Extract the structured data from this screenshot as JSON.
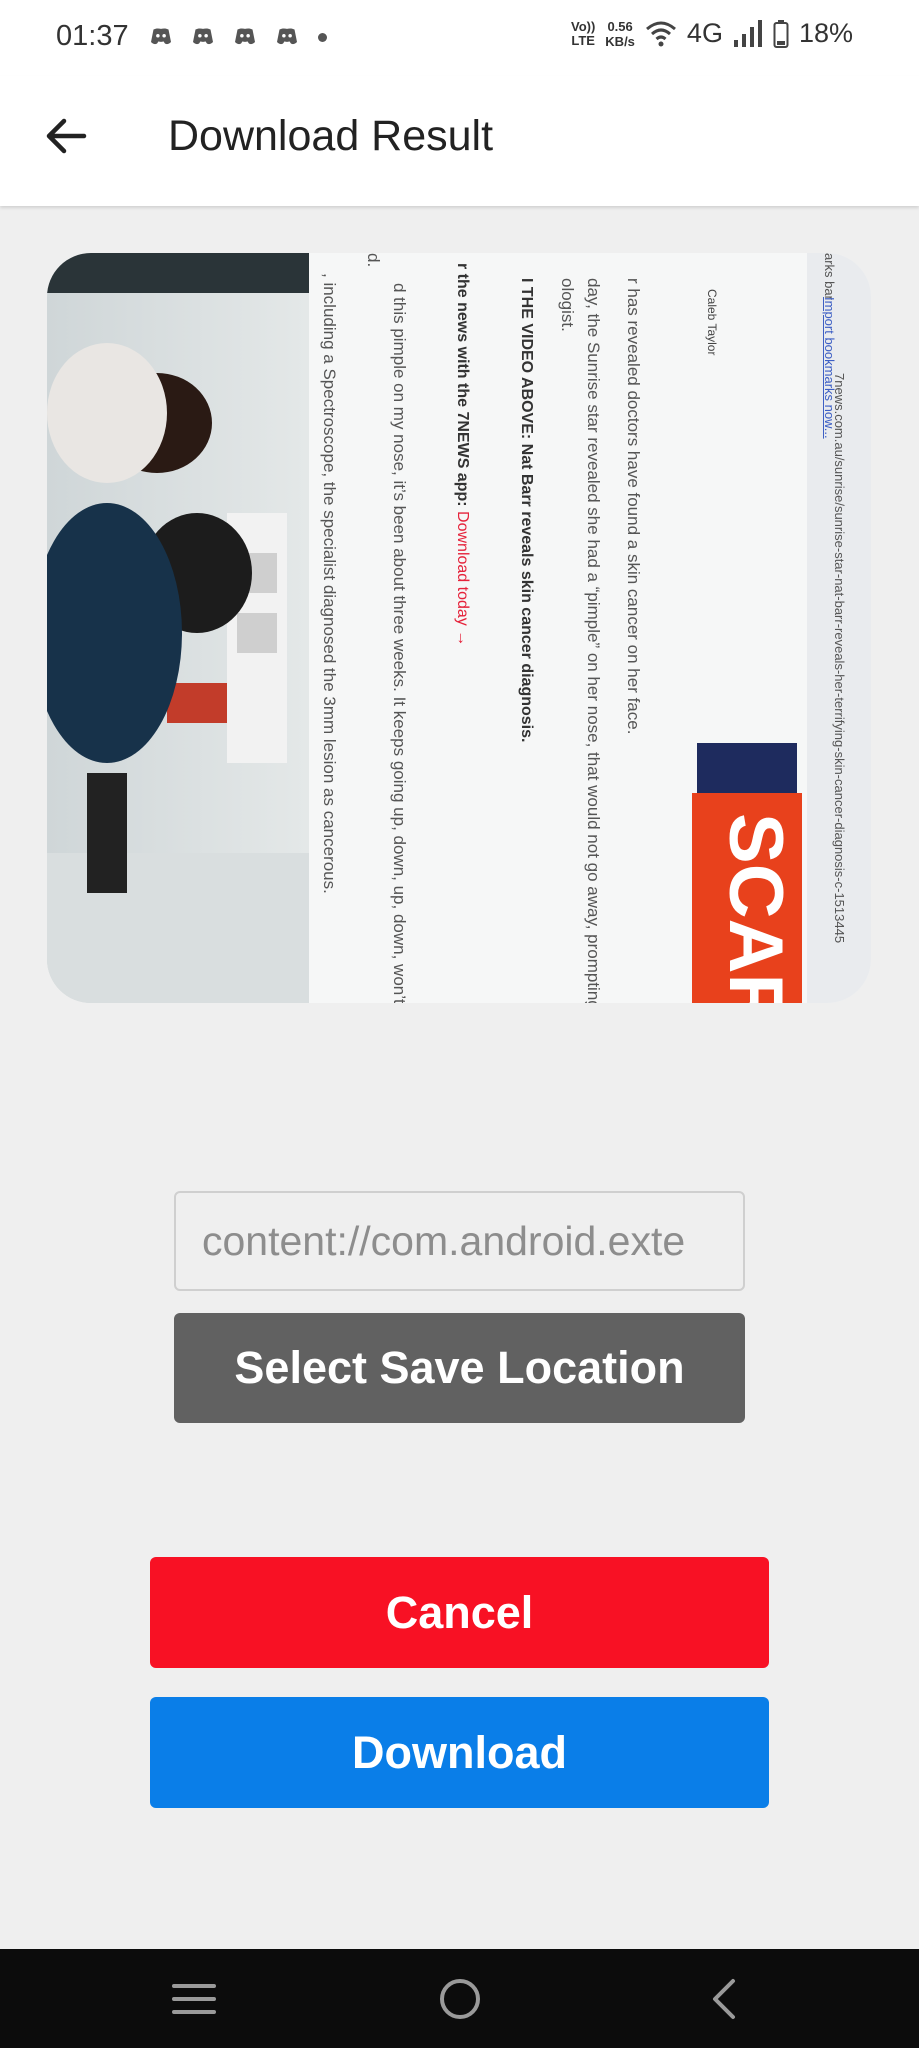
{
  "status_bar": {
    "time": "01:37",
    "volte": "Vo)) LTE",
    "volte_top": "Vo))",
    "volte_bottom": "LTE",
    "net_speed_value": "0.56",
    "net_speed_unit": "KB/s",
    "network_type": "4G",
    "battery": "18%",
    "icons": [
      "discord-icon",
      "discord-icon",
      "discord-icon",
      "discord-icon",
      "dot-icon",
      "wifi-icon",
      "signal-icon",
      "battery-icon"
    ]
  },
  "app_bar": {
    "title": "Download Result",
    "back_icon": "arrow-left-icon"
  },
  "preview": {
    "url_line": "7news.com.au/sunrise/sunrise-star-nat-barr-reveals-her-terrifying-skin-cancer-diagnosis-c-1513445",
    "bookmarks_prefix": "arks bar",
    "bookmarks_link": "Import bookmarks now...",
    "author": "Caleb Taylor",
    "lines": [
      "r has revealed doctors have found a skin cancer on her face.",
      "day, the Sunrise star revealed she had a “pimple” on her nose, that would not go away, prompting",
      "ologist."
    ],
    "bold_line": "I THE VIDEO ABOVE: Nat Barr reveals skin cancer diagnosis.",
    "app_line_prefix": "r the news with the 7NEWS app: ",
    "app_line_link": "Download today →",
    "quote_line": "d this pimple on my nose, it’s been about three weeks. It keeps going up, down, up, down, won’t go",
    "quote_end": "d.",
    "spectroscope_line": ", including a Spectroscope, the specialist diagnosed the 3mm lesion as cancerous.",
    "banner_text": "SCAR"
  },
  "form": {
    "path_value": "content://com.android.exte",
    "select_label": "Select Save Location",
    "cancel_label": "Cancel",
    "download_label": "Download"
  },
  "nav_bar": {
    "icons": [
      "menu-icon",
      "home-icon",
      "back-icon"
    ]
  },
  "colors": {
    "cancel": "#f81124",
    "download": "#0a7ee8",
    "select": "#616161",
    "background": "#efefef"
  }
}
